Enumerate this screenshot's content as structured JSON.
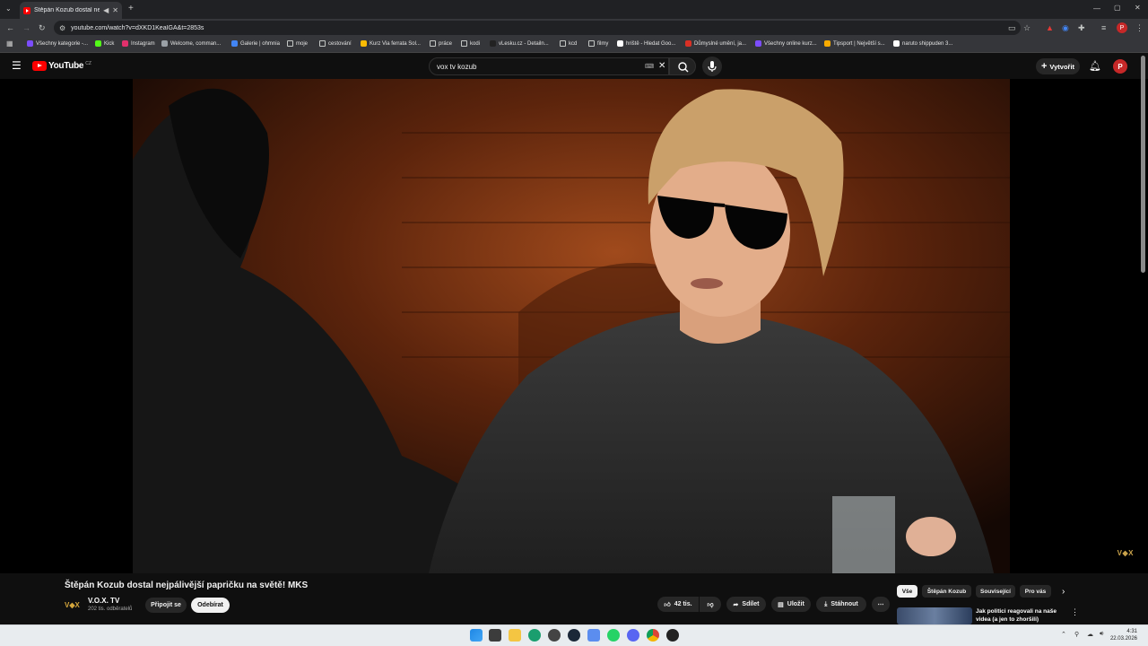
{
  "browser": {
    "tab_title": "Štěpán Kozub dostal nejpáliv",
    "url": "youtube.com/watch?v=dXKD1KeaIGA&t=2853s",
    "bookmarks": [
      {
        "label": "Všechny kategorie -...",
        "color": "#7c4dff"
      },
      {
        "label": "Kick",
        "color": "#53fc18"
      },
      {
        "label": "Instagram",
        "color": "#e1306c"
      },
      {
        "label": "Welcome, comman...",
        "color": "#9aa0a6"
      },
      {
        "label": "Galerie | ohmnia",
        "color": "#4285f4"
      },
      {
        "label": "moje",
        "color": "folder"
      },
      {
        "label": "cestování",
        "color": "folder"
      },
      {
        "label": "Kurz Via ferrata Sol...",
        "color": "#fbbc04"
      },
      {
        "label": "práce",
        "color": "folder"
      },
      {
        "label": "kodi",
        "color": "folder"
      },
      {
        "label": "vLesku.cz - Detailn...",
        "color": "#222222"
      },
      {
        "label": "kcd",
        "color": "folder"
      },
      {
        "label": "filmy",
        "color": "folder"
      },
      {
        "label": "hriště - Hledat Goo...",
        "color": "#ffffff"
      },
      {
        "label": "Důmyslné umění, ja...",
        "color": "#d93025"
      },
      {
        "label": "Všechny online kurz...",
        "color": "#7c4dff"
      },
      {
        "label": "Tipsport | Největší s...",
        "color": "#f9ab00"
      },
      {
        "label": "naruto shippuden 3...",
        "color": "#ffffff"
      }
    ]
  },
  "youtube": {
    "logo_text": "YouTube",
    "region": "CZ",
    "search_value": "vox tv kozub",
    "create_label": "Vytvořit",
    "avatar_letter": "P",
    "watermark": "V◆X"
  },
  "video": {
    "title": "Štěpán Kozub dostal nejpálivější papričku na světě! MKS",
    "channel_logo": "V◆X",
    "channel_name": "V.O.X. TV",
    "subscribers": "202 tis. odběratelů",
    "join_label": "Připojit se",
    "subscribe_label": "Odebírat",
    "likes": "42 tis.",
    "share_label": "Sdílet",
    "save_label": "Uložit",
    "download_label": "Stáhnout"
  },
  "chips": [
    "Vše",
    "Štěpán Kozub",
    "Související",
    "Pro vás"
  ],
  "recommendation": {
    "title": "Jak politici reagovali na naše videa (a jen to zhoršili)"
  },
  "taskbar": {
    "time": "4:31",
    "date": "22.03.2026"
  }
}
